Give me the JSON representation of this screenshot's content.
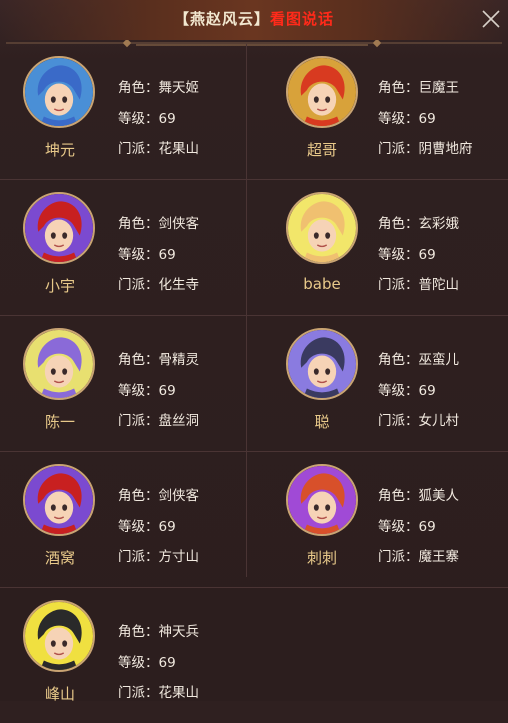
{
  "title": {
    "guild": "【燕赵风云】",
    "action": "看图说话"
  },
  "labels": {
    "role": "角色：",
    "level": "等级：",
    "school": "门派："
  },
  "members": [
    {
      "name": "坤元",
      "role": "舞天姬",
      "level": "69",
      "school": "花果山",
      "avatar_icon": "dancer-portrait-icon",
      "avatar_bg": "#4a8fd6"
    },
    {
      "name": "超哥",
      "role": "巨魔王",
      "level": "69",
      "school": "阴曹地府",
      "avatar_icon": "demon-king-portrait-icon",
      "avatar_bg": "#d8a23a"
    },
    {
      "name": "小宇",
      "role": "剑侠客",
      "level": "69",
      "school": "化生寺",
      "avatar_icon": "swordsman-portrait-icon",
      "avatar_bg": "#7b4ad0"
    },
    {
      "name": "babe",
      "role": "玄彩娥",
      "level": "69",
      "school": "普陀山",
      "avatar_icon": "fairy-portrait-icon",
      "avatar_bg": "#f2e66a"
    },
    {
      "name": "陈一",
      "role": "骨精灵",
      "level": "69",
      "school": "盘丝洞",
      "avatar_icon": "bone-spirit-portrait-icon",
      "avatar_bg": "#e8e070"
    },
    {
      "name": "聪",
      "role": "巫蛮儿",
      "level": "69",
      "school": "女儿村",
      "avatar_icon": "witch-girl-portrait-icon",
      "avatar_bg": "#8a7be0"
    },
    {
      "name": "酒窝",
      "role": "剑侠客",
      "level": "69",
      "school": "方寸山",
      "avatar_icon": "swordsman-portrait-icon",
      "avatar_bg": "#7b4ad0"
    },
    {
      "name": "刺刺",
      "role": "狐美人",
      "level": "69",
      "school": "魔王寨",
      "avatar_icon": "fox-beauty-portrait-icon",
      "avatar_bg": "#a04ad6"
    },
    {
      "name": "峰山",
      "role": "神天兵",
      "level": "69",
      "school": "花果山",
      "avatar_icon": "celestial-soldier-portrait-icon",
      "avatar_bg": "#f0e040"
    }
  ]
}
